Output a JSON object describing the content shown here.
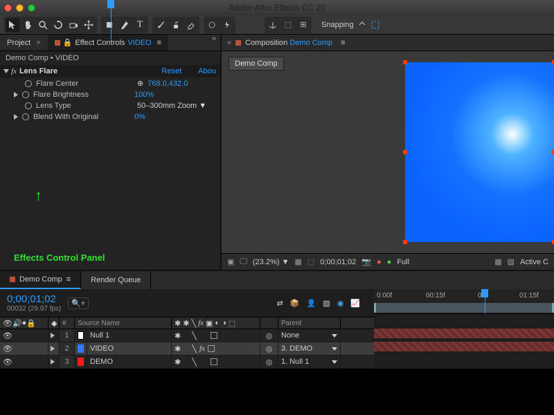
{
  "app_title": "Adobe After Effects CC 20",
  "snapping_label": "Snapping",
  "left_panel": {
    "tab_project": "Project",
    "tab_effects_prefix": "Effect Controls ",
    "tab_effects_layer": "VIDEO",
    "breadcrumb": "Demo Comp • VIDEO",
    "effect_name": "Lens Flare",
    "reset": "Reset",
    "about": "Abou",
    "props": {
      "flare_center": {
        "label": "Flare Center",
        "value": "768.0,432.0"
      },
      "brightness": {
        "label": "Flare Brightness",
        "value": "100%"
      },
      "lens_type": {
        "label": "Lens Type",
        "value": "50–300mm Zoom"
      },
      "blend": {
        "label": "Blend With Original",
        "value": "0%"
      }
    },
    "annotation": "Effects Control Panel"
  },
  "comp_panel": {
    "tab_prefix": "Composition ",
    "tab_name": "Demo Comp",
    "label": "Demo Comp",
    "viewbar": {
      "zoom": "(23.2%)",
      "timecode": "0;00;01;02",
      "res": "Full",
      "active": "Active C"
    }
  },
  "timeline": {
    "tab_comp": "Demo Comp",
    "tab_render": "Render Queue",
    "timecode": "0;00;01;02",
    "frame_info": "00032 (29.97 fps)",
    "cols": {
      "source": "Source Name",
      "parent": "Parent"
    },
    "ruler": [
      "0:00f",
      "00:15f",
      "01:",
      "01:15f"
    ],
    "layers": [
      {
        "num": "1",
        "color": "#ffffff",
        "name": "Null 1",
        "parent": "None",
        "selected": false,
        "fx": false,
        "swatch_border": "#000"
      },
      {
        "num": "2",
        "color": "#2c7bff",
        "name": "VIDEO",
        "parent": "3. DEMO",
        "selected": true,
        "fx": true,
        "swatch_border": "#2c7bff"
      },
      {
        "num": "3",
        "color": "#ff1a1a",
        "name": "DEMO",
        "parent": "1. Null 1",
        "selected": false,
        "fx": false,
        "swatch_border": "#ff1a1a"
      }
    ]
  }
}
